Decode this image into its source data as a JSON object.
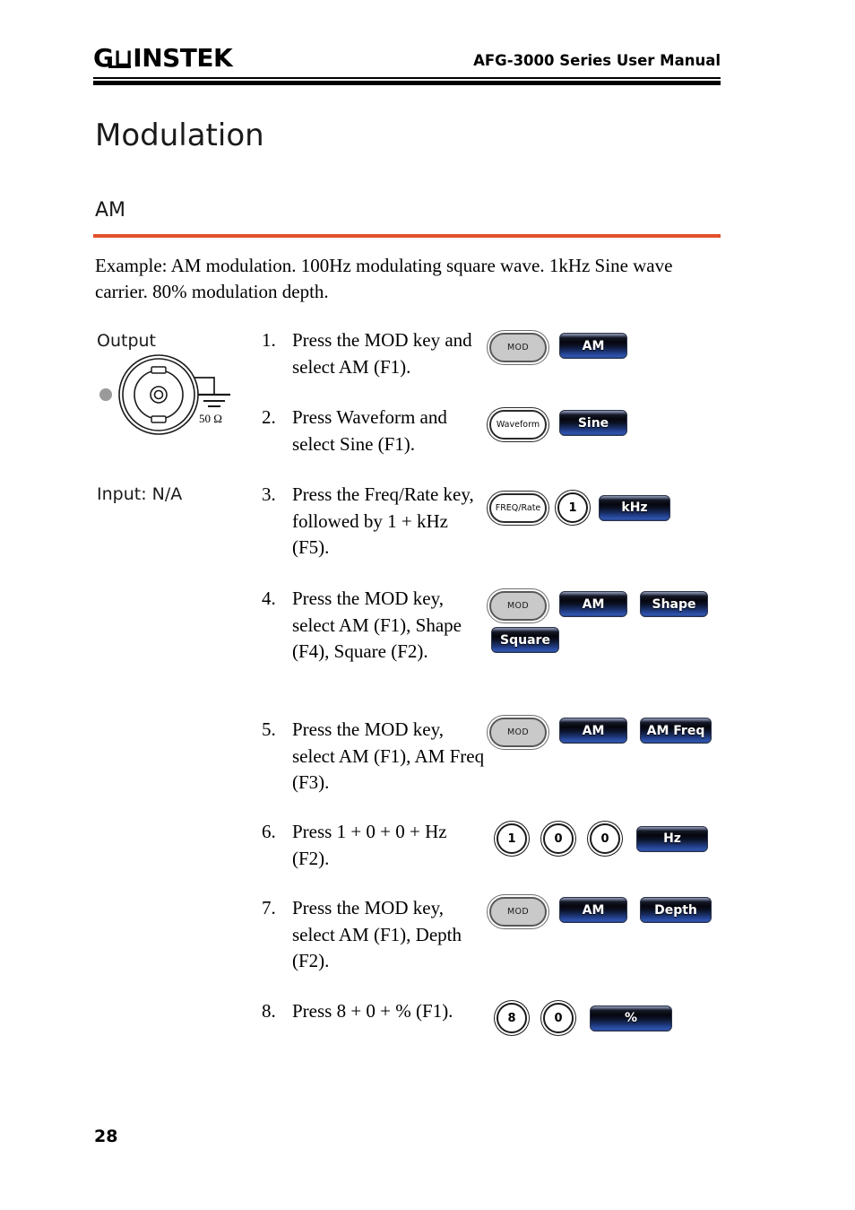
{
  "header": {
    "logo_gw": "G⊔",
    "logo_instek": "INSTEK",
    "title": "AFG-3000 Series User Manual"
  },
  "chapter": {
    "title": "Modulation"
  },
  "section": {
    "title": "AM",
    "accent_color": "#e2512c",
    "example": "Example: AM modulation. 100Hz modulating square wave. 1kHz Sine wave carrier. 80% modulation depth."
  },
  "connector": {
    "output_label": "Output",
    "impedance": "50 Ω",
    "input_label": "Input: N/A"
  },
  "steps": [
    {
      "num": "1.",
      "text": "Press the MOD key and select AM (F1).",
      "keys": [
        {
          "type": "hard",
          "label": "MOD"
        },
        {
          "type": "soft",
          "label": "AM"
        }
      ]
    },
    {
      "num": "2.",
      "text": "Press Waveform and select Sine (F1).",
      "keys": [
        {
          "type": "hard-white",
          "label": "Waveform"
        },
        {
          "type": "soft",
          "label": "Sine"
        }
      ]
    },
    {
      "num": "3.",
      "text": "Press the Freq/Rate key, followed by 1 + kHz (F5).",
      "keys": [
        {
          "type": "hard-white",
          "label": "FREQ/Rate"
        },
        {
          "type": "round",
          "label": "1"
        },
        {
          "type": "soft",
          "label": "kHz"
        }
      ]
    },
    {
      "num": "4.",
      "text": "Press the MOD key, select AM (F1), Shape (F4), Square (F2).",
      "keys": [
        {
          "type": "hard",
          "label": "MOD"
        },
        {
          "type": "soft",
          "label": "AM"
        },
        {
          "type": "soft",
          "label": "Shape"
        },
        {
          "type": "soft",
          "label": "Square"
        }
      ]
    },
    {
      "num": "5.",
      "text": "Press the MOD key, select AM (F1), AM Freq (F3).",
      "keys": [
        {
          "type": "hard",
          "label": "MOD"
        },
        {
          "type": "soft",
          "label": "AM"
        },
        {
          "type": "soft",
          "label": "AM Freq"
        }
      ]
    },
    {
      "num": "6.",
      "text": "Press 1 + 0 + 0 + Hz (F2).",
      "keys": [
        {
          "type": "round",
          "label": "1"
        },
        {
          "type": "round",
          "label": "0"
        },
        {
          "type": "round",
          "label": "0"
        },
        {
          "type": "soft",
          "label": "Hz"
        }
      ]
    },
    {
      "num": "7.",
      "text": "Press the MOD key, select AM (F1), Depth (F2).",
      "keys": [
        {
          "type": "hard",
          "label": "MOD"
        },
        {
          "type": "soft",
          "label": "AM"
        },
        {
          "type": "soft",
          "label": "Depth"
        }
      ]
    },
    {
      "num": "8.",
      "text": "Press 8 + 0 + % (F1).",
      "keys": [
        {
          "type": "round",
          "label": "8"
        },
        {
          "type": "round",
          "label": "0"
        },
        {
          "type": "soft",
          "label": "%"
        }
      ]
    }
  ],
  "footer": {
    "page_number": "28"
  }
}
